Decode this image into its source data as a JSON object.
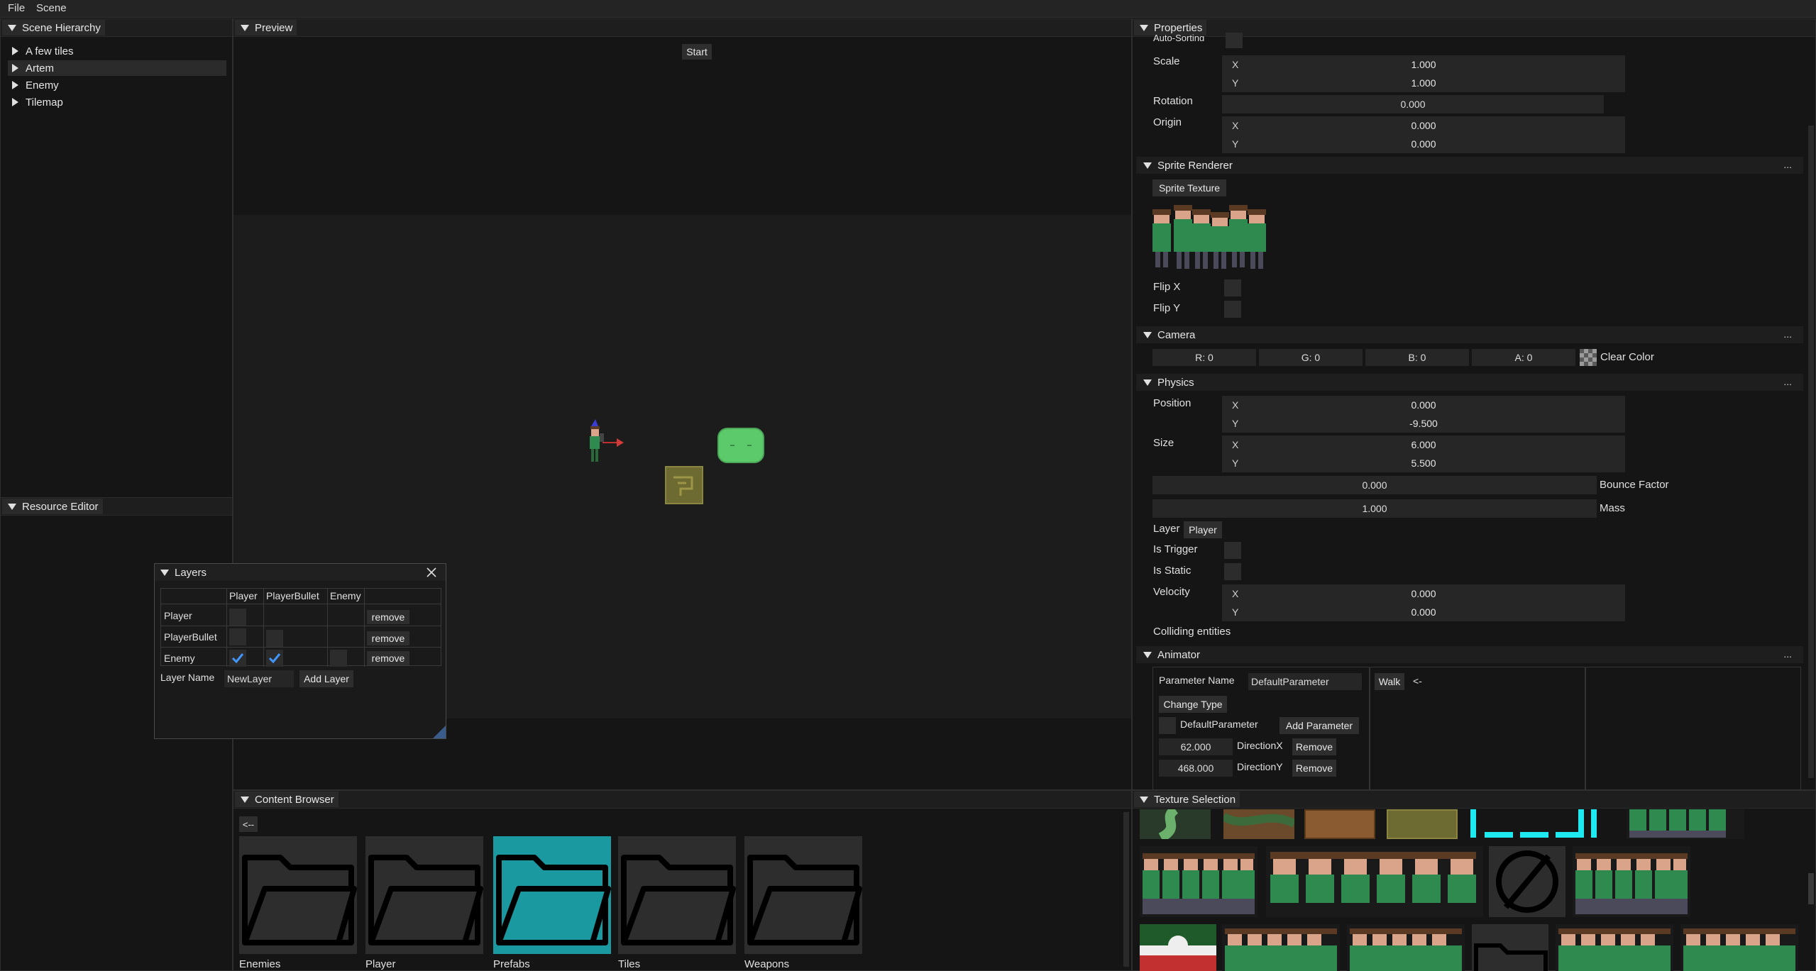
{
  "menubar": {
    "file": "File",
    "scene": "Scene"
  },
  "scene_hierarchy": {
    "title": "Scene Hierarchy",
    "items": [
      {
        "label": "A few tiles"
      },
      {
        "label": "Artem"
      },
      {
        "label": "Enemy"
      },
      {
        "label": "Tilemap"
      }
    ],
    "selected": "Artem"
  },
  "resource_editor": {
    "title": "Resource Editor"
  },
  "preview": {
    "title": "Preview",
    "start_label": "Start"
  },
  "layers": {
    "title": "Layers",
    "columns": [
      "Player",
      "PlayerBullet",
      "Enemy"
    ],
    "rows": [
      {
        "name": "Player",
        "checks": [
          false
        ],
        "remove": "remove"
      },
      {
        "name": "PlayerBullet",
        "checks": [
          false,
          false
        ],
        "remove": "remove"
      },
      {
        "name": "Enemy",
        "checks": [
          true,
          true,
          false
        ],
        "remove": "remove"
      }
    ],
    "layer_name_label": "Layer Name",
    "layer_name_value": "NewLayer",
    "add_layer": "Add Layer"
  },
  "content_browser": {
    "title": "Content Browser",
    "back": "<--",
    "folders": [
      "Enemies",
      "Player",
      "Prefabs",
      "Tiles",
      "Weapons"
    ],
    "selected": "Prefabs"
  },
  "properties": {
    "title": "Properties",
    "auto_sorting": "Auto-Sorting",
    "scale_label": "Scale",
    "scale": {
      "x": "1.000",
      "y": "1.000"
    },
    "rotation_label": "Rotation",
    "rotation": "0.000",
    "origin_label": "Origin",
    "origin": {
      "x": "0.000",
      "y": "0.000"
    },
    "sprite_renderer": {
      "title": "Sprite Renderer",
      "texture_button": "Sprite Texture",
      "flip_x": "Flip X",
      "flip_y": "Flip Y"
    },
    "camera": {
      "title": "Camera",
      "r": "R: 0",
      "g": "G: 0",
      "b": "B: 0",
      "a": "A: 0",
      "clear_color": "Clear Color"
    },
    "physics": {
      "title": "Physics",
      "position_label": "Position",
      "position": {
        "x": "0.000",
        "y": "-9.500"
      },
      "size_label": "Size",
      "size": {
        "x": "6.000",
        "y": "5.500"
      },
      "bounce_value": "0.000",
      "bounce_label": "Bounce Factor",
      "mass_value": "1.000",
      "mass_label": "Mass",
      "layer_label": "Layer",
      "layer_value": "Player",
      "is_trigger": "Is Trigger",
      "is_static": "Is Static",
      "velocity_label": "Velocity",
      "velocity": {
        "x": "0.000",
        "y": "0.000"
      },
      "colliding": "Colliding entities"
    },
    "animator": {
      "title": "Animator",
      "param_name_label": "Parameter Name",
      "param_name_value": "DefaultParameter",
      "change_type": "Change Type",
      "default_param": "DefaultParameter",
      "add_param": "Add Parameter",
      "params": [
        {
          "value": "62.000",
          "name": "DirectionX",
          "remove": "Remove"
        },
        {
          "value": "468.000",
          "name": "DirectionY",
          "remove": "Remove"
        }
      ],
      "walk": "Walk",
      "arrow": "<-"
    },
    "axis_x": "X",
    "axis_y": "Y",
    "more": "..."
  },
  "texture_selection": {
    "title": "Texture Selection"
  },
  "colors": {
    "accent_teal": "#1a9aa0",
    "check_blue": "#4296fa",
    "slime": "#5cc96a"
  }
}
